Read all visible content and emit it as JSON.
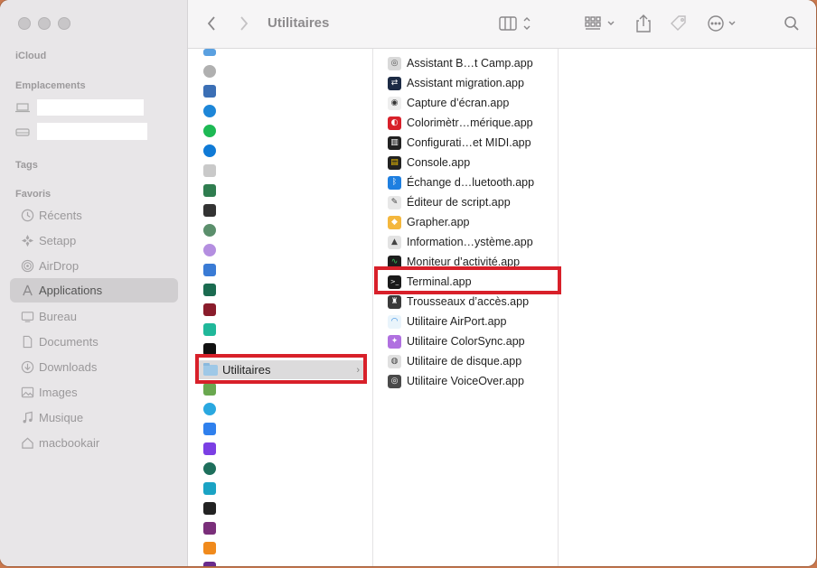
{
  "window": {
    "title": "Utilitaires"
  },
  "sidebar": {
    "sections": {
      "icloud": "iCloud",
      "locations": "Emplacements",
      "tags": "Tags",
      "favorites": "Favoris"
    },
    "favorites": [
      {
        "label": "Récents",
        "icon": "clock-icon"
      },
      {
        "label": "Setapp",
        "icon": "setapp-icon"
      },
      {
        "label": "AirDrop",
        "icon": "airdrop-icon"
      },
      {
        "label": "Applications",
        "icon": "applications-icon",
        "active": true
      },
      {
        "label": "Bureau",
        "icon": "desktop-icon"
      },
      {
        "label": "Documents",
        "icon": "document-icon"
      },
      {
        "label": "Downloads",
        "icon": "download-icon"
      },
      {
        "label": "Images",
        "icon": "images-icon"
      },
      {
        "label": "Musique",
        "icon": "music-icon"
      },
      {
        "label": "macbookair",
        "icon": "home-icon"
      }
    ]
  },
  "column1": {
    "selected_folder": "Utilitaires",
    "icon_colors": [
      "#5aa0e0",
      "#b0b0b0",
      "#3b6fb5",
      "#1d86d8",
      "#1db954",
      "#0f7ad6",
      "#c9c9c9",
      "#2f7d4f",
      "#333333",
      "#5b8f6c",
      "#b48ee0",
      "#3a7bd5",
      "#1b6b50",
      "#8a1c2b",
      "#20b89a",
      "#111111",
      "#6aa84f",
      "#2aa8e0",
      "#2f80ed",
      "#7b3fe4",
      "#1e6f5c",
      "#1aa3c4",
      "#222222",
      "#7a2f7a",
      "#f08a1c",
      "#6a2b8c"
    ]
  },
  "column2": {
    "apps": [
      {
        "name": "Assistant B…t Camp.app",
        "icon": "boot-camp-icon",
        "bg": "#d9d9d9",
        "fg": "#555555",
        "glyph": "◎"
      },
      {
        "name": "Assistant migration.app",
        "icon": "migration-icon",
        "bg": "#1c2a44",
        "fg": "#ffffff",
        "glyph": "⇄"
      },
      {
        "name": "Capture d’écran.app",
        "icon": "screenshot-icon",
        "bg": "#eeeeee",
        "fg": "#333333",
        "glyph": "◉"
      },
      {
        "name": "Colorimètr…mérique.app",
        "icon": "colorimeter-icon",
        "bg": "#d8202a",
        "fg": "#ffffff",
        "glyph": "◐"
      },
      {
        "name": "Configurati…et MIDI.app",
        "icon": "midi-icon",
        "bg": "#222222",
        "fg": "#ffffff",
        "glyph": "▥"
      },
      {
        "name": "Console.app",
        "icon": "console-icon",
        "bg": "#222222",
        "fg": "#f2c200",
        "glyph": "▤"
      },
      {
        "name": "Échange d…luetooth.app",
        "icon": "bluetooth-icon",
        "bg": "#1e7fe0",
        "fg": "#ffffff",
        "glyph": "ᛒ"
      },
      {
        "name": "Éditeur de script.app",
        "icon": "script-editor-icon",
        "bg": "#e7e7e7",
        "fg": "#444444",
        "glyph": "✎"
      },
      {
        "name": "Grapher.app",
        "icon": "grapher-icon",
        "bg": "#f4b73d",
        "fg": "#ffffff",
        "glyph": "◆"
      },
      {
        "name": "Information…ystème.app",
        "icon": "system-info-icon",
        "bg": "#e3e3e3",
        "fg": "#444444",
        "glyph": "▲"
      },
      {
        "name": "Moniteur d’activité.app",
        "icon": "activity-monitor-icon",
        "bg": "#1d1d1d",
        "fg": "#35c759",
        "glyph": "∿"
      },
      {
        "name": "Terminal.app",
        "icon": "terminal-icon",
        "bg": "#1a1a1a",
        "fg": "#ffffff",
        "glyph": ">_"
      },
      {
        "name": "Trousseaux d’accès.app",
        "icon": "keychain-icon",
        "bg": "#3a3a3a",
        "fg": "#ffffff",
        "glyph": "♜"
      },
      {
        "name": "Utilitaire AirPort.app",
        "icon": "airport-icon",
        "bg": "#e9f4fb",
        "fg": "#1e7fe0",
        "glyph": "◠"
      },
      {
        "name": "Utilitaire ColorSync.app",
        "icon": "colorsync-icon",
        "bg": "#b070e0",
        "fg": "#ffffff",
        "glyph": "✦"
      },
      {
        "name": "Utilitaire de disque.app",
        "icon": "disk-utility-icon",
        "bg": "#e0e0e0",
        "fg": "#444444",
        "glyph": "◍"
      },
      {
        "name": "Utilitaire VoiceOver.app",
        "icon": "voiceover-icon",
        "bg": "#4a4a4a",
        "fg": "#ffffff",
        "glyph": "◎"
      }
    ]
  }
}
